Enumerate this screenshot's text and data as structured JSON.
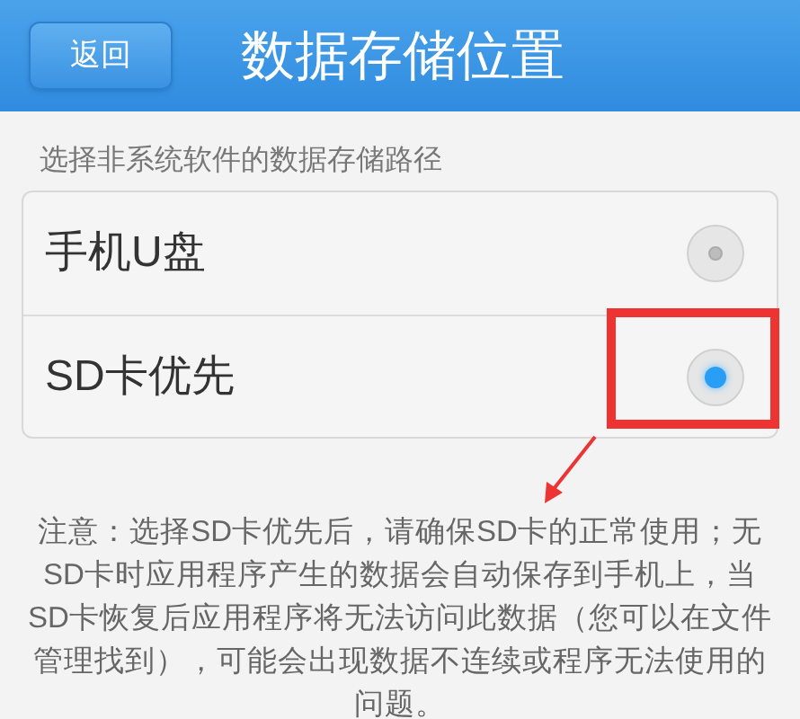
{
  "header": {
    "back_button": "返回",
    "title": "数据存储位置"
  },
  "section_label": "选择非系统软件的数据存储路径",
  "options": [
    {
      "label": "手机U盘",
      "selected": false
    },
    {
      "label": "SD卡优先",
      "selected": true
    }
  ],
  "note": "注意：选择SD卡优先后，请确保SD卡的正常使用；无SD卡时应用程序产生的数据会自动保存到手机上，当SD卡恢复后应用程序将无法访问此数据（您可以在文件管理找到），可能会出现数据不连续或程序无法使用的问题。"
}
